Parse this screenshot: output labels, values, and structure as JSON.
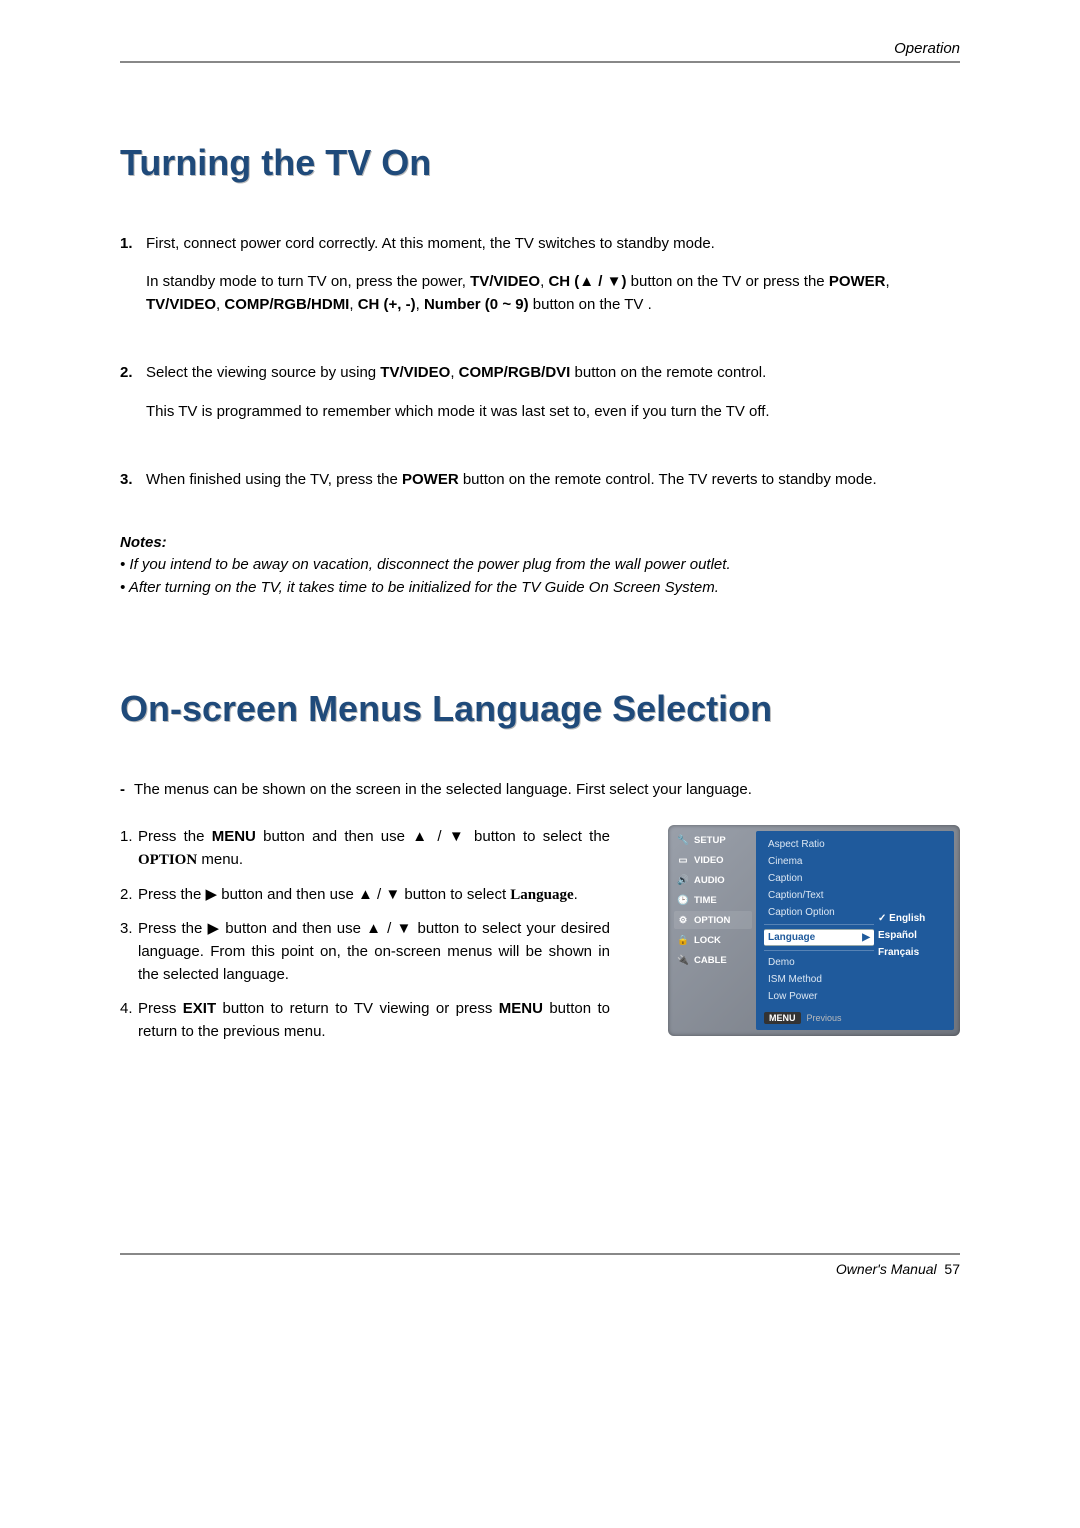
{
  "header": {
    "section": "Operation"
  },
  "section1": {
    "title": "Turning the TV On",
    "step1_num": "1.",
    "step1a": "First, connect power cord correctly. At this moment, the TV switches to standby mode.",
    "step1b_pre": "In standby mode to turn TV on, press the power, ",
    "step1b_b1": "TV/VIDEO",
    "step1b_mid1": ", ",
    "step1b_b2": "CH (▲  / ▼)",
    "step1b_mid2": " button on the TV or press the ",
    "step1b_b3": "POWER",
    "step1b_mid3": ", ",
    "step1b_b4": "TV/VIDEO",
    "step1b_mid4": ", ",
    "step1b_b5": "COMP/RGB/HDMI",
    "step1b_mid5": ", ",
    "step1b_b6": "CH (+,  -)",
    "step1b_mid6": ", ",
    "step1b_b7": "Number (0 ~ 9)",
    "step1b_end": " button on the TV .",
    "step2_num": "2.",
    "step2a_pre": "Select the viewing source by using ",
    "step2a_b1": "TV/VIDEO",
    "step2a_mid": ", ",
    "step2a_b2": "COMP/RGB/DVI",
    "step2a_end": "  button on the remote control.",
    "step2b": "This TV is programmed to remember which mode it was last set to, even if you turn the TV off.",
    "step3_num": "3.",
    "step3_pre": "When finished using the TV, press the ",
    "step3_b1": "POWER",
    "step3_end": " button on the remote control. The TV reverts to standby mode.",
    "notes_label": "Notes:",
    "note1": "• If you intend to be away on vacation, disconnect the power plug from the wall power outlet.",
    "note2": "• After turning on the TV, it takes time to be initialized for the TV Guide On Screen System."
  },
  "section2": {
    "title": "On-screen Menus Language Selection",
    "dash": "-",
    "intro": "The menus can be shown on the screen in the selected language. First select your language.",
    "s1_n": "1.",
    "s1_pre": "Press the ",
    "s1_b1": "MENU",
    "s1_mid": " button and then use ▲  / ▼  button to select the ",
    "s1_b2": "OPTION",
    "s1_end": " menu.",
    "s2_n": "2.",
    "s2_pre": "Press the ▶  button and then use ▲  / ▼  button to select ",
    "s2_b1": "Language",
    "s2_end": ".",
    "s3_n": "3.",
    "s3": "Press the ▶  button and then use ▲  / ▼ button to select your desired language. From this point on, the on-screen menus will be shown in the selected language.",
    "s4_n": "4.",
    "s4_pre": "Press ",
    "s4_b1": "EXIT",
    "s4_mid": " button to return to TV viewing or press ",
    "s4_b2": "MENU",
    "s4_end": " button to return to the previous menu."
  },
  "osd": {
    "tabs": [
      "SETUP",
      "VIDEO",
      "AUDIO",
      "TIME",
      "OPTION",
      "LOCK",
      "CABLE"
    ],
    "items": [
      "Aspect Ratio",
      "Cinema",
      "Caption",
      "Caption/Text",
      "Caption Option",
      "Language",
      "Demo",
      "ISM Method",
      "Low Power"
    ],
    "selected_item": "Language",
    "arrow": "▶",
    "sub_selected": "English",
    "sub_items": [
      "English",
      "Español",
      "Français"
    ],
    "footer_btn": "MENU",
    "footer_text": "Previous"
  },
  "footer": {
    "label": "Owner's Manual",
    "page": "57"
  }
}
